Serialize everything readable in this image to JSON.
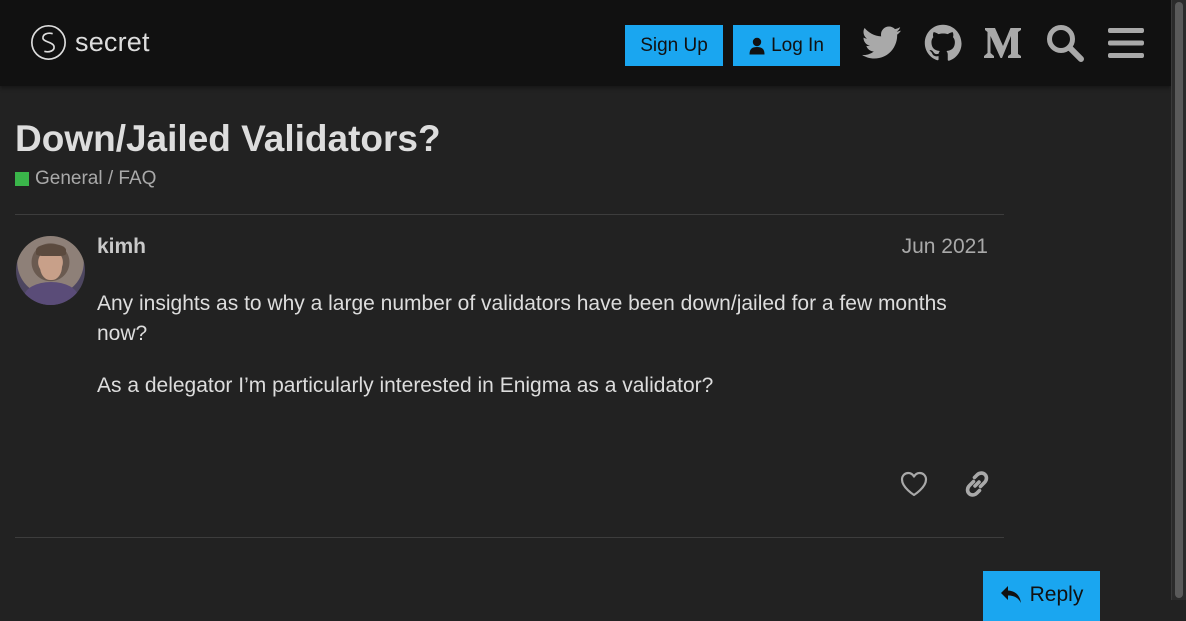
{
  "header": {
    "logo_text": "secret",
    "signup_label": "Sign Up",
    "login_label": "Log In",
    "icons": [
      "twitter-icon",
      "github-icon",
      "medium-icon",
      "search-icon",
      "hamburger-menu-icon"
    ]
  },
  "topic": {
    "title": "Down/Jailed Validators?",
    "category": "General / FAQ",
    "category_color": "#3ab54a"
  },
  "post": {
    "username": "kimh",
    "date": "Jun 2021",
    "paragraphs": [
      "Any insights as to why a large number of validators have been down/jailed for a few months now?",
      "As a delegator I’m particularly interested in Enigma as a validator?"
    ],
    "actions": [
      "heart-icon",
      "link-icon"
    ]
  },
  "reply_label": "Reply",
  "colors": {
    "accent": "#1aa6f0",
    "header_bg": "#111111",
    "page_bg": "#222222"
  }
}
